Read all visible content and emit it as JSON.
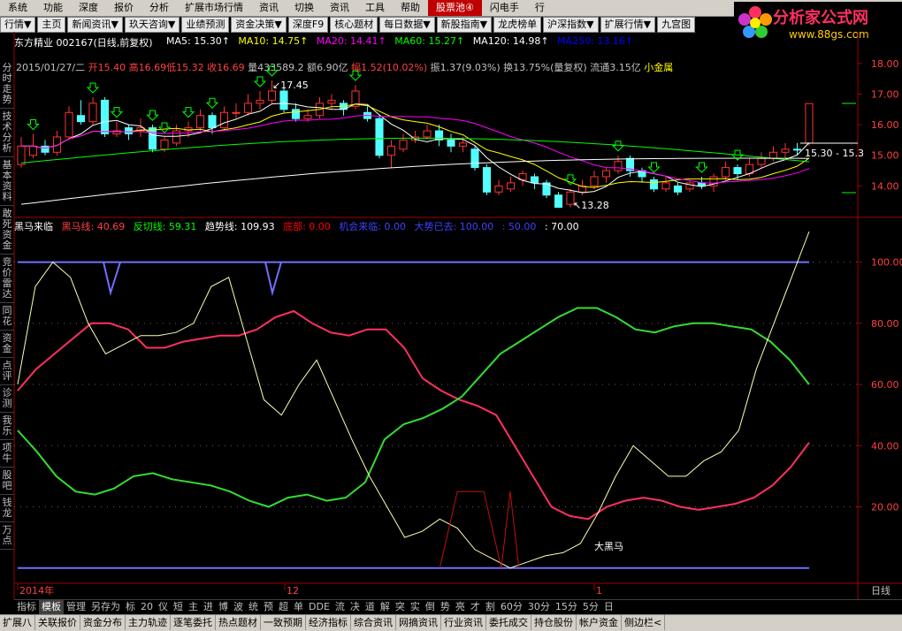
{
  "menu": [
    "系统",
    "功能",
    "深度",
    "报价",
    "分析",
    "扩展市场行情",
    "资讯",
    "切换",
    "资讯",
    "工具",
    "帮助",
    "股票池④",
    "闪电手",
    "行"
  ],
  "nav": [
    "行情▼",
    "主页",
    "新闻资讯▼",
    "玖天咨询▼",
    "业绩预测",
    "资金决策▼",
    "深度F9",
    "核心题材",
    "每日数据▼",
    "新股指南▼",
    "龙虎榜单",
    "沪深指数▼",
    "扩展行情▼",
    "九宫图"
  ],
  "logo": {
    "title": "分析家公式网",
    "url": "www.88gs.com"
  },
  "left_tabs": [
    "分时走势",
    "技术分析",
    "基本资料",
    "敢死资金",
    "竞价雷达",
    "同花",
    "资金",
    "点评",
    "诊测",
    "我乐",
    "项牛",
    "股吧",
    "钱龙",
    "万点"
  ],
  "stock": {
    "name": "东方精业",
    "code": "002167",
    "period": "(日线,前复权)"
  },
  "ma_legend": [
    {
      "label": "MA5: 15.30",
      "color": "#ffffff"
    },
    {
      "label": "MA10: 14.75",
      "color": "#ffff00"
    },
    {
      "label": "MA20: 14.41",
      "color": "#ff00ff"
    },
    {
      "label": "MA60: 15.27",
      "color": "#00ff00"
    },
    {
      "label": "MA120: 14.98",
      "color": "#ffffff"
    },
    {
      "label": "MA250: 13.16",
      "color": "#0000ff"
    }
  ],
  "quote": {
    "date": "2015/01/27/二",
    "open": "开15.40",
    "high": "高16.69",
    "low": "低15.32",
    "close": "收16.69",
    "vol": "量433589.2",
    "amt": "额6.90亿",
    "chg": "幅1.52(10.02%)",
    "amp": "振1.37(9.03%)",
    "turn": "换13.75%(量复权)",
    "flow": "流通3.15亿",
    "tag": "小金属"
  },
  "indicator": {
    "name": "黑马来临",
    "items": [
      {
        "label": "黑马线: 40.69",
        "color": "#ff4040"
      },
      {
        "label": "反切线: 59.31",
        "color": "#00ff00"
      },
      {
        "label": "趋势线: 109.93",
        "color": "#ffffff"
      },
      {
        "label": "底部: 0.00",
        "color": "#ff0000"
      },
      {
        "label": "机会来临: 0.00",
        "color": "#4040ff"
      },
      {
        "label": "大势已去: 100.00",
        "color": "#4040ff"
      },
      {
        "label": ": 50.00",
        "color": "#4040ff"
      },
      {
        "label": ": 70.00",
        "color": "#ffffff"
      }
    ],
    "annotation": "大黑马"
  },
  "price_axis": [
    "18.00",
    "17.00",
    "16.00",
    "15.00",
    "14.00"
  ],
  "ind_axis": [
    "100.00",
    "80.00",
    "60.00",
    "40.00",
    "20.00"
  ],
  "price_labels": {
    "high": "17.45",
    "low": "13.28",
    "cur": "15.30 - 15.3"
  },
  "date_axis": [
    "2014年",
    "12",
    "1"
  ],
  "period_label": "日线",
  "bottom_tabs": [
    "指标",
    "模板",
    "管理",
    "另存为",
    "标",
    "20",
    "仪",
    "短",
    "主",
    "进",
    "博",
    "波",
    "统",
    "预",
    "超",
    "单",
    "DDE",
    "流",
    "决",
    "道",
    "解",
    "突",
    "实",
    "倒",
    "势",
    "亮",
    "才",
    "割",
    "60分",
    "30分",
    "15分",
    "5分",
    "日"
  ],
  "bottom_selected": "模板",
  "status_tabs": [
    "扩展八",
    "关联报价",
    "资金分布",
    "主力轨迹",
    "逐笔委托",
    "热点题材",
    "一致预期",
    "经济指标",
    "综合资讯",
    "网摘资讯",
    "行业资讯",
    "委托成交",
    "持仓股份",
    "帐户资金",
    "侧边栏<"
  ],
  "chart_data": {
    "type": "candlestick",
    "price_ylim": [
      13.0,
      18.4
    ],
    "candles": [
      [
        14.7,
        15.3,
        15.6,
        14.6
      ],
      [
        15.0,
        15.3,
        15.7,
        14.9
      ],
      [
        15.3,
        15.1,
        15.5,
        15.0
      ],
      [
        15.1,
        15.6,
        15.8,
        15.0
      ],
      [
        15.6,
        16.4,
        16.6,
        15.5
      ],
      [
        16.3,
        16.1,
        16.8,
        16.0
      ],
      [
        16.1,
        16.7,
        16.9,
        16.0
      ],
      [
        16.8,
        15.7,
        16.9,
        15.6
      ],
      [
        15.7,
        15.8,
        16.1,
        15.6
      ],
      [
        15.9,
        15.7,
        16.0,
        15.5
      ],
      [
        15.8,
        15.9,
        16.2,
        15.6
      ],
      [
        15.9,
        15.2,
        16.0,
        15.1
      ],
      [
        15.2,
        15.5,
        15.6,
        15.1
      ],
      [
        15.4,
        15.8,
        16.0,
        15.3
      ],
      [
        15.8,
        15.9,
        16.1,
        15.6
      ],
      [
        15.9,
        16.3,
        16.5,
        15.8
      ],
      [
        16.3,
        15.9,
        16.4,
        15.7
      ],
      [
        15.9,
        16.4,
        16.6,
        15.8
      ],
      [
        16.4,
        16.4,
        16.7,
        16.2
      ],
      [
        16.4,
        16.7,
        17.0,
        16.3
      ],
      [
        16.7,
        16.8,
        17.1,
        16.5
      ],
      [
        16.8,
        17.1,
        17.45,
        16.7
      ],
      [
        17.1,
        16.5,
        17.2,
        16.4
      ],
      [
        16.5,
        16.2,
        16.7,
        16.1
      ],
      [
        16.2,
        16.3,
        16.5,
        16.1
      ],
      [
        16.3,
        16.7,
        16.9,
        16.2
      ],
      [
        16.7,
        16.8,
        17.0,
        16.5
      ],
      [
        16.7,
        16.5,
        16.8,
        16.3
      ],
      [
        16.6,
        17.1,
        17.3,
        16.5
      ],
      [
        16.4,
        16.2,
        16.6,
        16.1
      ],
      [
        16.2,
        15.0,
        16.3,
        14.9
      ],
      [
        15.0,
        15.3,
        15.5,
        14.6
      ],
      [
        15.2,
        15.5,
        15.7,
        15.1
      ],
      [
        15.5,
        15.6,
        15.8,
        15.4
      ],
      [
        15.6,
        15.8,
        16.0,
        15.5
      ],
      [
        15.8,
        15.5,
        16.0,
        15.3
      ],
      [
        15.5,
        15.3,
        15.7,
        15.1
      ],
      [
        15.3,
        15.4,
        15.6,
        15.1
      ],
      [
        15.2,
        14.6,
        15.3,
        14.5
      ],
      [
        14.6,
        13.8,
        14.7,
        13.7
      ],
      [
        13.8,
        14.0,
        14.2,
        13.7
      ],
      [
        13.9,
        14.1,
        14.3,
        13.8
      ],
      [
        14.2,
        14.4,
        14.5,
        14.0
      ],
      [
        14.3,
        14.1,
        14.4,
        13.9
      ],
      [
        14.1,
        13.7,
        14.2,
        13.6
      ],
      [
        13.7,
        13.3,
        13.8,
        13.28
      ],
      [
        13.4,
        13.8,
        13.9,
        13.3
      ],
      [
        13.8,
        14.0,
        14.2,
        13.7
      ],
      [
        14.0,
        14.3,
        14.5,
        13.9
      ],
      [
        14.3,
        14.5,
        14.6,
        14.1
      ],
      [
        14.5,
        14.8,
        15.0,
        14.4
      ],
      [
        14.9,
        14.5,
        15.0,
        14.3
      ],
      [
        14.5,
        14.3,
        14.6,
        14.1
      ],
      [
        14.2,
        13.9,
        14.3,
        13.8
      ],
      [
        13.9,
        14.1,
        14.3,
        13.8
      ],
      [
        14.0,
        13.8,
        14.1,
        13.7
      ],
      [
        13.9,
        14.1,
        14.2,
        13.8
      ],
      [
        14.1,
        14.0,
        14.3,
        13.9
      ],
      [
        14.0,
        14.3,
        14.4,
        13.8
      ],
      [
        14.3,
        14.6,
        14.8,
        14.2
      ],
      [
        14.6,
        14.4,
        14.7,
        14.2
      ],
      [
        14.4,
        14.7,
        14.9,
        14.3
      ],
      [
        14.7,
        14.9,
        15.1,
        14.6
      ],
      [
        14.9,
        15.1,
        15.3,
        14.8
      ],
      [
        15.1,
        15.2,
        15.4,
        14.9
      ],
      [
        15.2,
        15.17,
        15.4,
        15.0
      ],
      [
        15.4,
        16.69,
        16.69,
        15.32
      ]
    ],
    "ind_ylim": [
      -5,
      110
    ],
    "heima": [
      58,
      65,
      70,
      75,
      80,
      80,
      78,
      72,
      72,
      74,
      75,
      76,
      76,
      78,
      82,
      84,
      80,
      77,
      76,
      78,
      78,
      72,
      62,
      58,
      55,
      53,
      50,
      40,
      30,
      20,
      17,
      16,
      20,
      22,
      23,
      22,
      20,
      19,
      20,
      21,
      23,
      27,
      33,
      41
    ],
    "fanqie": [
      45,
      38,
      30,
      25,
      24,
      26,
      30,
      31,
      29,
      28,
      27,
      25,
      22,
      20,
      23,
      24,
      22,
      23,
      28,
      42,
      47,
      49,
      52,
      56,
      63,
      70,
      74,
      78,
      82,
      85,
      85,
      82,
      78,
      77,
      79,
      80,
      80,
      79,
      78,
      74,
      68,
      60
    ],
    "trend": [
      60,
      92,
      100,
      95,
      80,
      70,
      73,
      76,
      76,
      77,
      80,
      92,
      95,
      75,
      55,
      50,
      60,
      68,
      55,
      42,
      30,
      20,
      10,
      12,
      16,
      13,
      6,
      3,
      0,
      2,
      4,
      5,
      8,
      18,
      30,
      40,
      35,
      30,
      30,
      35,
      38,
      45,
      65,
      80,
      95,
      110
    ],
    "bottom": [
      [
        24,
        0
      ],
      [
        25,
        25
      ],
      [
        26.5,
        25
      ],
      [
        27.5,
        0
      ],
      [
        28,
        25
      ],
      [
        28.5,
        0
      ]
    ],
    "lines": {
      "upper": 100,
      "lower": 0
    },
    "arrows": [
      1,
      6,
      8,
      11,
      12,
      14,
      16,
      20,
      21,
      28,
      46,
      50,
      53,
      57,
      60
    ]
  }
}
